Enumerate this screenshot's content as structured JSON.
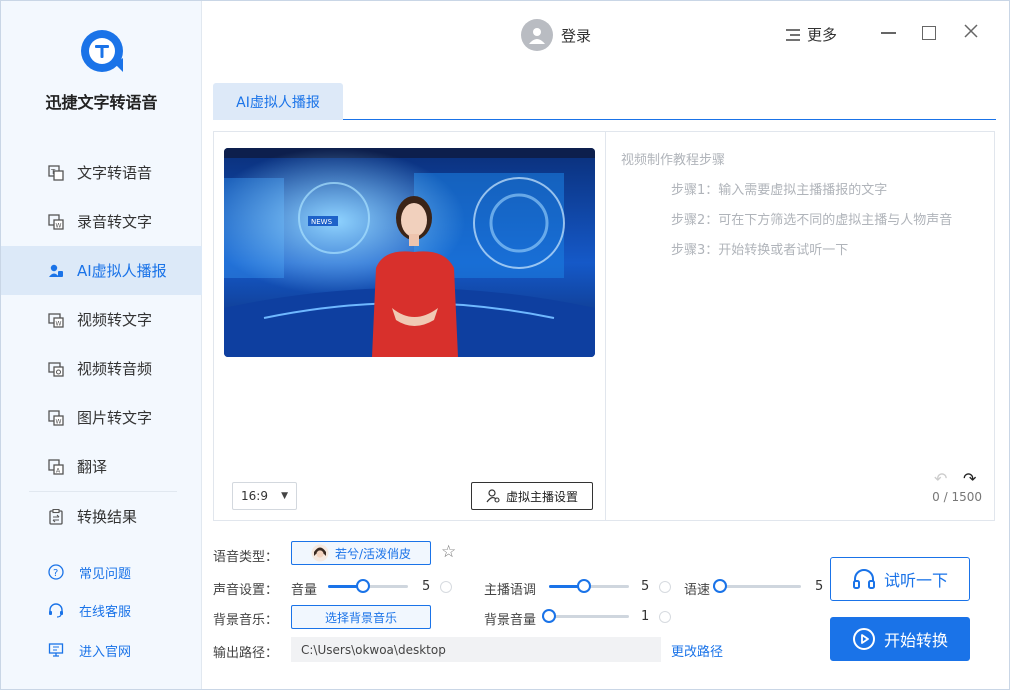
{
  "app": {
    "name": "迅捷文字转语音"
  },
  "sidebar": {
    "items": [
      {
        "label": "文字转语音",
        "icon": "text-to-speech-icon"
      },
      {
        "label": "录音转文字",
        "icon": "recording-to-text-icon"
      },
      {
        "label": "AI虚拟人播报",
        "icon": "ai-avatar-icon",
        "active": true
      },
      {
        "label": "视频转文字",
        "icon": "video-to-text-icon"
      },
      {
        "label": "视频转音频",
        "icon": "video-to-audio-icon"
      },
      {
        "label": "图片转文字",
        "icon": "image-to-text-icon"
      },
      {
        "label": "翻译",
        "icon": "translate-icon"
      },
      {
        "label": "转换结果",
        "icon": "results-icon"
      }
    ],
    "links": [
      {
        "label": "常见问题",
        "icon": "help-icon"
      },
      {
        "label": "在线客服",
        "icon": "headset-icon"
      },
      {
        "label": "进入官网",
        "icon": "monitor-icon"
      }
    ]
  },
  "header": {
    "login": "登录",
    "more": "更多"
  },
  "tabs": [
    {
      "label": "AI虚拟人播报"
    }
  ],
  "editor": {
    "aspect_ratio": "16:9",
    "avatar_settings": "虚拟主播设置",
    "guide_title": "视频制作教程步骤",
    "steps": [
      "步骤1：输入需要虚拟主播播报的文字",
      "步骤2：可在下方筛选不同的虚拟主播与人物声音",
      "步骤3：开始转换或者试听一下"
    ],
    "counter": "0 / 1500"
  },
  "settings": {
    "voice_type_label": "语音类型：",
    "voice_type_value": "若兮/活泼俏皮",
    "sound_label": "声音设置：",
    "volume_label": "音量",
    "volume_value": "5",
    "pitch_label": "主播语调",
    "pitch_value": "5",
    "speed_label": "语速",
    "speed_value": "5",
    "bgm_label": "背景音乐：",
    "bgm_button": "选择背景音乐",
    "bgm_volume_label": "背景音量",
    "bgm_volume_value": "1",
    "output_label": "输出路径：",
    "output_path": "C:\\Users\\okwoa\\desktop",
    "change_path": "更改路径"
  },
  "actions": {
    "listen": "试听一下",
    "start": "开始转换"
  },
  "colors": {
    "accent": "#1a73e8",
    "sidebar_bg": "#f3f8fe",
    "active_bg": "#dce9f8"
  }
}
